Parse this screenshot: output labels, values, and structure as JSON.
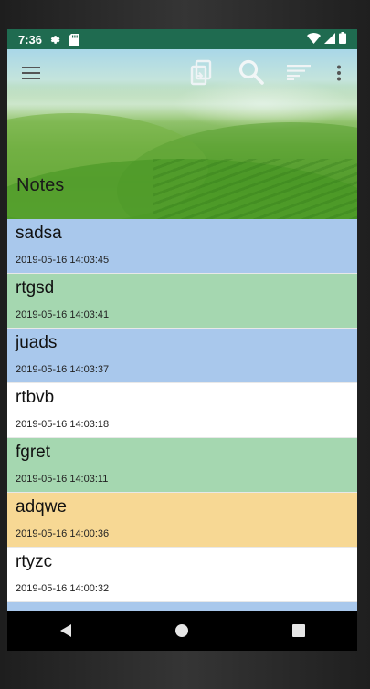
{
  "status_bar": {
    "time": "7:36",
    "icons_left": [
      "settings-icon",
      "sd-card-icon"
    ],
    "icons_right": [
      "wifi-icon",
      "cell-signal-icon",
      "battery-icon"
    ],
    "color": "#1f6b50"
  },
  "toolbar": {
    "icons": [
      "menu-icon",
      "export-icon",
      "search-icon",
      "sort-icon",
      "more-vert-icon"
    ]
  },
  "header": {
    "title": "Notes"
  },
  "notes": [
    {
      "title": "sadsa",
      "date": "2019-05-16 14:03:45",
      "color": "#a9c8ec"
    },
    {
      "title": "rtgsd",
      "date": "2019-05-16 14:03:41",
      "color": "#a5d7b0"
    },
    {
      "title": "juads",
      "date": "2019-05-16 14:03:37",
      "color": "#a9c8ec"
    },
    {
      "title": "rtbvb",
      "date": "2019-05-16 14:03:18",
      "color": "#ffffff"
    },
    {
      "title": "fgret",
      "date": "2019-05-16 14:03:11",
      "color": "#a5d7b0"
    },
    {
      "title": "adqwe",
      "date": "2019-05-16 14:00:36",
      "color": "#f7d894"
    },
    {
      "title": "rtyzc",
      "date": "2019-05-16 14:00:32",
      "color": "#ffffff"
    },
    {
      "title": "",
      "date": "",
      "color": "#a9c8ec"
    }
  ],
  "nav_bar": {
    "icons": [
      "back-icon",
      "home-icon",
      "recents-icon"
    ]
  }
}
